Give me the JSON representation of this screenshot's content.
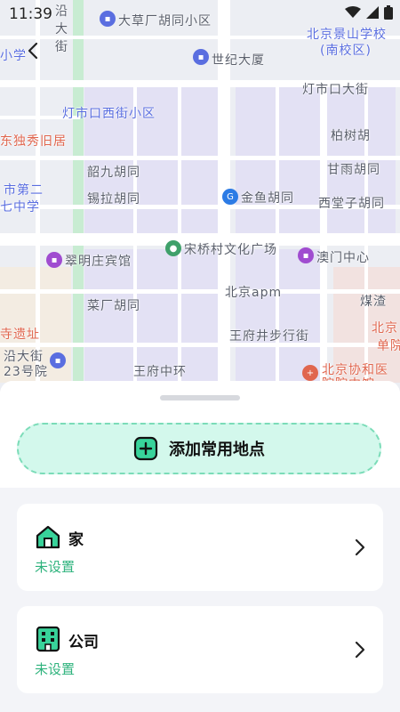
{
  "status": {
    "time": "11:39"
  },
  "map": {
    "labels": [
      {
        "text": "沿",
        "cls": ""
      },
      {
        "text": "大",
        "cls": ""
      },
      {
        "text": "街",
        "cls": ""
      },
      {
        "text": "大草厂胡同小区",
        "cls": ""
      },
      {
        "text": "北京景山学校",
        "cls": ""
      },
      {
        "text": "(南校区)",
        "cls": ""
      },
      {
        "text": "世纪大厦",
        "cls": ""
      },
      {
        "text": "灯市口大街",
        "cls": ""
      },
      {
        "text": "灯市口西街小区",
        "cls": "blue"
      },
      {
        "text": "柏树胡",
        "cls": ""
      },
      {
        "text": "东独秀旧居",
        "cls": "red"
      },
      {
        "text": "韶九胡同",
        "cls": ""
      },
      {
        "text": "甘雨胡同",
        "cls": ""
      },
      {
        "text": "锡拉胡同",
        "cls": ""
      },
      {
        "text": "金鱼胡同",
        "cls": ""
      },
      {
        "text": "西堂子胡同",
        "cls": ""
      },
      {
        "text": "市第二",
        "cls": "blue"
      },
      {
        "text": "七中学",
        "cls": "blue"
      },
      {
        "text": "宋桥村文化广场",
        "cls": ""
      },
      {
        "text": "翠明庄宾馆",
        "cls": ""
      },
      {
        "text": "澳门中心",
        "cls": ""
      },
      {
        "text": "北京apm",
        "cls": ""
      },
      {
        "text": "煤渣",
        "cls": ""
      },
      {
        "text": "菜厂胡同",
        "cls": ""
      },
      {
        "text": "王府井步行街",
        "cls": ""
      },
      {
        "text": "北京",
        "cls": "red"
      },
      {
        "text": "单院",
        "cls": "red"
      },
      {
        "text": "寺遗址",
        "cls": "red"
      },
      {
        "text": "沿大街",
        "cls": ""
      },
      {
        "text": "23号院",
        "cls": ""
      },
      {
        "text": "王府中环",
        "cls": ""
      },
      {
        "text": "北京协和医",
        "cls": "red"
      },
      {
        "text": "院院中馆",
        "cls": "red"
      },
      {
        "text": "小学",
        "cls": "blue"
      }
    ]
  },
  "sheet": {
    "add_label": "添加常用地点",
    "cards": [
      {
        "title": "家",
        "sub": "未设置"
      },
      {
        "title": "公司",
        "sub": "未设置"
      }
    ]
  },
  "colors": {
    "accent": "#2fb37d",
    "add_bg": "#d3f8ec",
    "add_border": "#7bdcb8"
  }
}
